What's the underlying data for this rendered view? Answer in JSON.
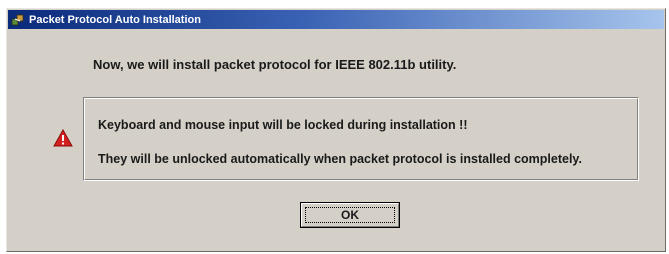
{
  "window": {
    "title": "Packet Protocol Auto Installation",
    "title_icon": "app-icon"
  },
  "dialog": {
    "intro_text": "Now, we will install packet protocol for IEEE 802.11b utility.",
    "warning_icon": "warning-icon",
    "message_line_1": "Keyboard and mouse input will be locked during installation !!",
    "message_line_2": "They will be unlocked automatically when packet protocol is installed completely.",
    "ok_label": "OK"
  },
  "colors": {
    "dialog_bg": "#d4d0c8",
    "titlebar_start": "#0a2a7a",
    "titlebar_end": "#a6c4ec",
    "warning_red": "#d42020"
  }
}
